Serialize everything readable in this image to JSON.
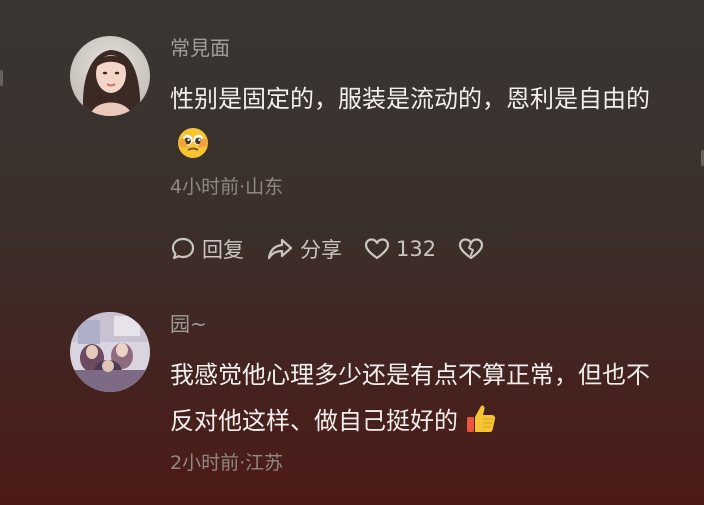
{
  "comments": [
    {
      "username": "常見面",
      "text": "性别是固定的，服装是流动的，恩利是自由的",
      "emoji": "face-holding-back-tears",
      "meta": "4小时前·山东",
      "actions": {
        "reply_label": "回复",
        "share_label": "分享",
        "like_count": "132"
      }
    },
    {
      "username": "园~",
      "text": "我感觉他心理多少还是有点不算正常，但也不反对他这样、做自己挺好的",
      "emoji": "thumbs-up",
      "meta": "2小时前·江苏"
    }
  ]
}
